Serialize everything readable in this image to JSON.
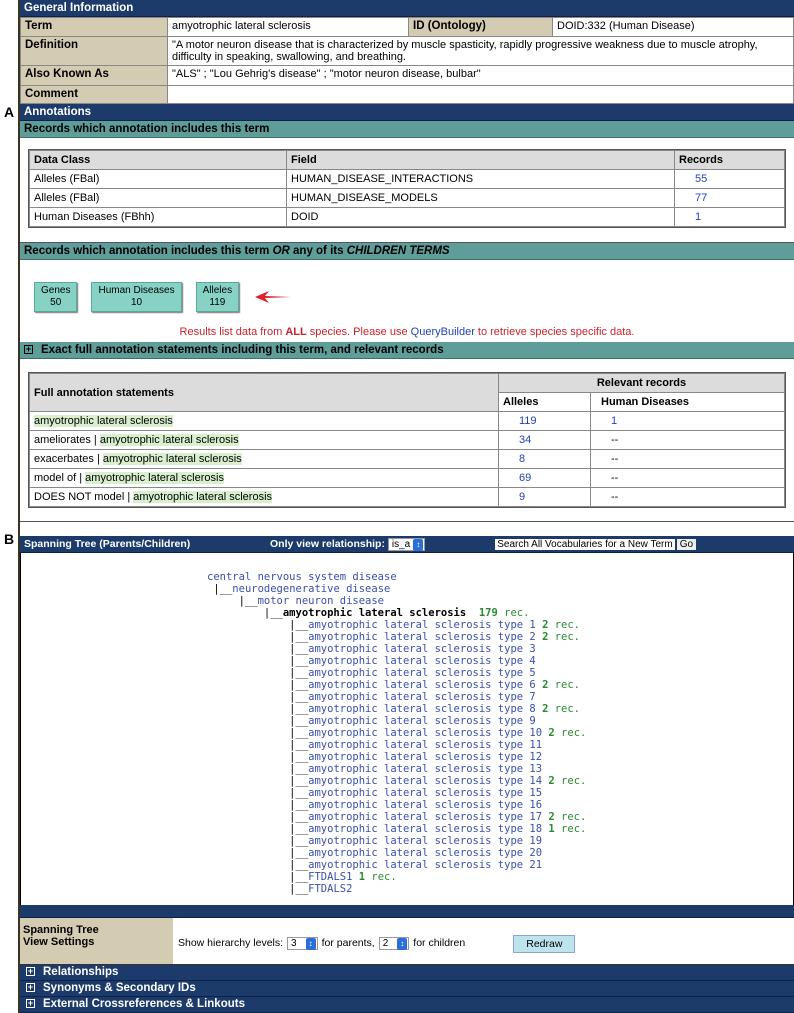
{
  "figure_labels": {
    "a": "A",
    "b": "B"
  },
  "general": {
    "header": "General Information",
    "term_label": "Term",
    "term": "amyotrophic lateral sclerosis",
    "id_label": "ID (Ontology)",
    "id": "DOID:332 (Human Disease)",
    "definition_label": "Definition",
    "definition": "\"A motor neuron disease that is characterized by muscle spasticity, rapidly progressive weakness due to muscle atrophy, difficulty in speaking, swallowing, and breathing.",
    "aka_label": "Also Known As",
    "aka": "\"ALS\" ; \"Lou Gehrig's disease\" ; \"motor neuron disease, bulbar\"",
    "comment_label": "Comment",
    "comment": ""
  },
  "annotations": {
    "header": "Annotations",
    "records_header": "Records which annotation includes this term",
    "columns": [
      "Data Class",
      "Field",
      "Records"
    ],
    "rows": [
      [
        "Alleles (FBal)",
        "HUMAN_DISEASE_INTERACTIONS",
        "55"
      ],
      [
        "Alleles (FBal)",
        "HUMAN_DISEASE_MODELS",
        "77"
      ],
      [
        "Human Diseases (FBhh)",
        "DOID",
        "1"
      ]
    ],
    "children_header": {
      "a": "Records which annotation includes this term ",
      "or": "OR",
      "b": " any of its ",
      "children": "CHILDREN TERMS"
    },
    "buttons": [
      {
        "label": "Genes",
        "count": "50"
      },
      {
        "label": "Human Diseases",
        "count": "10"
      },
      {
        "label": "Alleles",
        "count": "119"
      }
    ],
    "note": {
      "a": "Results list data from ",
      "all": "ALL",
      "b": " species. Please use ",
      "link": "QueryBuilder",
      "c": " to retrieve species specific data."
    },
    "exact_header": "Exact full annotation statements including this term, and relevant records",
    "stmt_header": "Full annotation statements",
    "relevant_header": "Relevant records",
    "alleles_header": "Alleles",
    "hd_header": "Human Diseases",
    "statements": [
      {
        "prefix": "",
        "term": "amyotrophic lateral sclerosis",
        "alleles": "119",
        "hd": "1"
      },
      {
        "prefix": "ameliorates | ",
        "term": "amyotrophic lateral sclerosis",
        "alleles": "34",
        "hd": "--"
      },
      {
        "prefix": "exacerbates | ",
        "term": "amyotrophic lateral sclerosis",
        "alleles": "8",
        "hd": "--"
      },
      {
        "prefix": "model of | ",
        "term": "amyotrophic lateral sclerosis",
        "alleles": "69",
        "hd": "--"
      },
      {
        "prefix": "DOES NOT model | ",
        "term": "amyotrophic lateral sclerosis",
        "alleles": "9",
        "hd": "--"
      }
    ]
  },
  "tree": {
    "header": "Spanning Tree (Parents/Children)",
    "rel_label": "Only view relationship:",
    "rel_value": "is_a",
    "search_label": "Search All Vocabularies for a New Term",
    "go": "Go",
    "parents": [
      "central nervous system disease",
      "neurodegenerative disease",
      "motor neuron disease"
    ],
    "current": {
      "name": "amyotrophic lateral sclerosis",
      "count": "179",
      "unit": "rec."
    },
    "children": [
      {
        "name": "amyotrophic lateral sclerosis type 1",
        "count": "2"
      },
      {
        "name": "amyotrophic lateral sclerosis type 2",
        "count": "2"
      },
      {
        "name": "amyotrophic lateral sclerosis type 3"
      },
      {
        "name": "amyotrophic lateral sclerosis type 4"
      },
      {
        "name": "amyotrophic lateral sclerosis type 5"
      },
      {
        "name": "amyotrophic lateral sclerosis type 6",
        "count": "2"
      },
      {
        "name": "amyotrophic lateral sclerosis type 7"
      },
      {
        "name": "amyotrophic lateral sclerosis type 8",
        "count": "2"
      },
      {
        "name": "amyotrophic lateral sclerosis type 9"
      },
      {
        "name": "amyotrophic lateral sclerosis type 10",
        "count": "2"
      },
      {
        "name": "amyotrophic lateral sclerosis type 11"
      },
      {
        "name": "amyotrophic lateral sclerosis type 12"
      },
      {
        "name": "amyotrophic lateral sclerosis type 13"
      },
      {
        "name": "amyotrophic lateral sclerosis type 14",
        "count": "2"
      },
      {
        "name": "amyotrophic lateral sclerosis type 15"
      },
      {
        "name": "amyotrophic lateral sclerosis type 16"
      },
      {
        "name": "amyotrophic lateral sclerosis type 17",
        "count": "2"
      },
      {
        "name": "amyotrophic lateral sclerosis type 18",
        "count": "1"
      },
      {
        "name": "amyotrophic lateral sclerosis type 19"
      },
      {
        "name": "amyotrophic lateral sclerosis type 20"
      },
      {
        "name": "amyotrophic lateral sclerosis type 21"
      },
      {
        "name": "FTDALS1",
        "count": "1"
      },
      {
        "name": "FTDALS2"
      }
    ]
  },
  "settings": {
    "label1": "Spanning Tree",
    "label2": "View Settings",
    "show": "Show hierarchy levels:",
    "parents_value": "3",
    "for_parents": "for parents,",
    "children_value": "2",
    "for_children": "for children",
    "redraw": "Redraw"
  },
  "sections": [
    "Relationships",
    "Synonyms & Secondary IDs",
    "External Crossreferences & Linkouts"
  ]
}
